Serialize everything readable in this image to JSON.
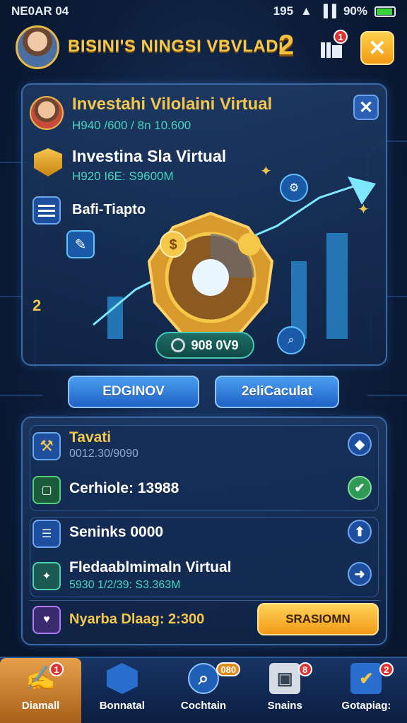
{
  "status_bar": {
    "left": "NE0AR 04",
    "time": "195",
    "battery": "90%"
  },
  "header": {
    "title": "BISINI'S NINGSI VBVLADI",
    "level": "2",
    "notif_count": "1"
  },
  "investment_panel": {
    "items": [
      {
        "title": "Investahi Vilolaini Virtual",
        "sub": "H940 /600 / 8n 10.600"
      },
      {
        "title": "Investina Sla Virtual",
        "sub": "H920 I6E: S9600M"
      },
      {
        "title": "Bafi-Tiapto",
        "sub": ""
      }
    ],
    "side_badge": "2",
    "pill_value": "908 0V9",
    "progress": 0.72
  },
  "buttons": {
    "left": "EDGINOV",
    "right": "2eliCaculat"
  },
  "list_panel": {
    "rows": [
      {
        "title": "Tavati",
        "sub": "0012.30/9090"
      },
      {
        "title": "Cerhiole: 13988",
        "sub": ""
      },
      {
        "title": "Seninks 0000",
        "sub": ""
      },
      {
        "title": "Fledaablmimaln Virtual",
        "sub": "5930 1/2/39: S3.363M"
      },
      {
        "title": "Nyarba Dlaag: 2:300",
        "sub": ""
      }
    ],
    "claim_label": "SRASIOMN"
  },
  "nav": [
    {
      "label": "Diamall",
      "badge": "1",
      "icon": "pencil-icon"
    },
    {
      "label": "Bonnatal",
      "badge": "",
      "icon": "shield-icon"
    },
    {
      "label": "Cochtain",
      "badge": "080",
      "icon": "search-icon"
    },
    {
      "label": "Snains",
      "badge": "8",
      "icon": "box-icon"
    },
    {
      "label": "Gotapiag:",
      "badge": "2",
      "icon": "cube-icon"
    }
  ],
  "colors": {
    "accent_gold": "#f3c64c",
    "panel_border": "#3b6aa6",
    "teal": "#46d4c2"
  }
}
